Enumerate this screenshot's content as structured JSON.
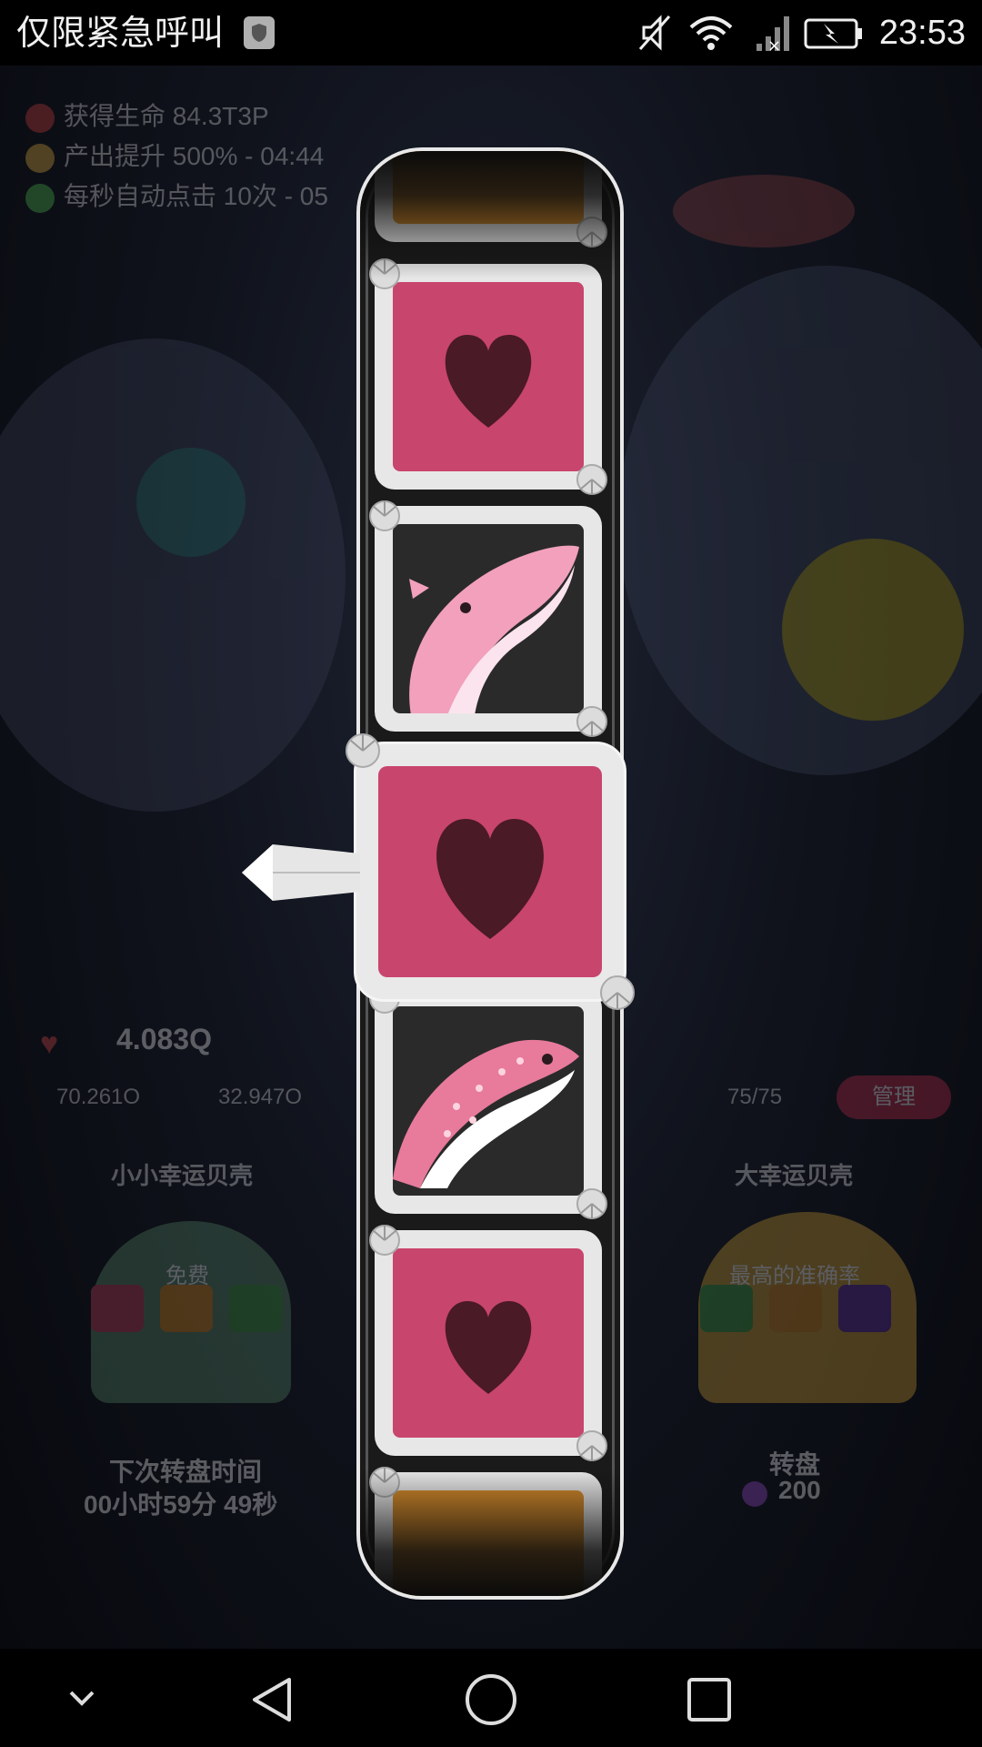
{
  "status_bar": {
    "carrier_text": "仅限紧急呼叫",
    "time": "23:53",
    "icons": [
      "shield-icon",
      "mute-icon",
      "wifi-icon",
      "signal-icon",
      "battery-charging-icon"
    ]
  },
  "background": {
    "buffs": [
      {
        "text": "获得生命 84.3T3P",
        "icon": "heart-coral-icon",
        "color": "#d04040"
      },
      {
        "text": "产出提升 500% - 04:44",
        "icon": "fish-icon",
        "color": "#e0b040"
      },
      {
        "text": "每秒自动点击 10次 - 05",
        "icon": "fish-icon",
        "color": "#50c050"
      }
    ],
    "heart_count": "4.083Q",
    "rate_tap": "70.261O",
    "rate_second": "32.947O",
    "fish_count": "75/75",
    "manage_label": "管理",
    "lucky_small_title": "小小幸运贝壳",
    "lucky_big_title": "大幸运贝壳",
    "free_label": "免费",
    "accuracy_label": "最高的准确率",
    "next_spin_label": "下次转盘时间",
    "next_spin_timer": "00小时59分 49秒",
    "spin_label": "转盘",
    "spin_cost": "200"
  },
  "reel": {
    "tiles": [
      {
        "symbol": "gold-chest-icon"
      },
      {
        "symbol": "heart-icon"
      },
      {
        "symbol": "pink-whale-icon"
      },
      {
        "symbol": "heart-icon",
        "selected": true
      },
      {
        "symbol": "whale-shark-icon"
      },
      {
        "symbol": "heart-icon"
      },
      {
        "symbol": "gold-chest-icon"
      }
    ],
    "colors": {
      "heart_bg": "#c8456d",
      "heart": "#4a1a26",
      "whale": "#f2a0bc",
      "tile_frame": "#e7e7e7",
      "gold_bg": "#d48a2a"
    }
  },
  "nav_bar": {
    "icons": [
      "hide-keyboard-icon",
      "back-icon",
      "home-icon",
      "recent-apps-icon"
    ]
  }
}
